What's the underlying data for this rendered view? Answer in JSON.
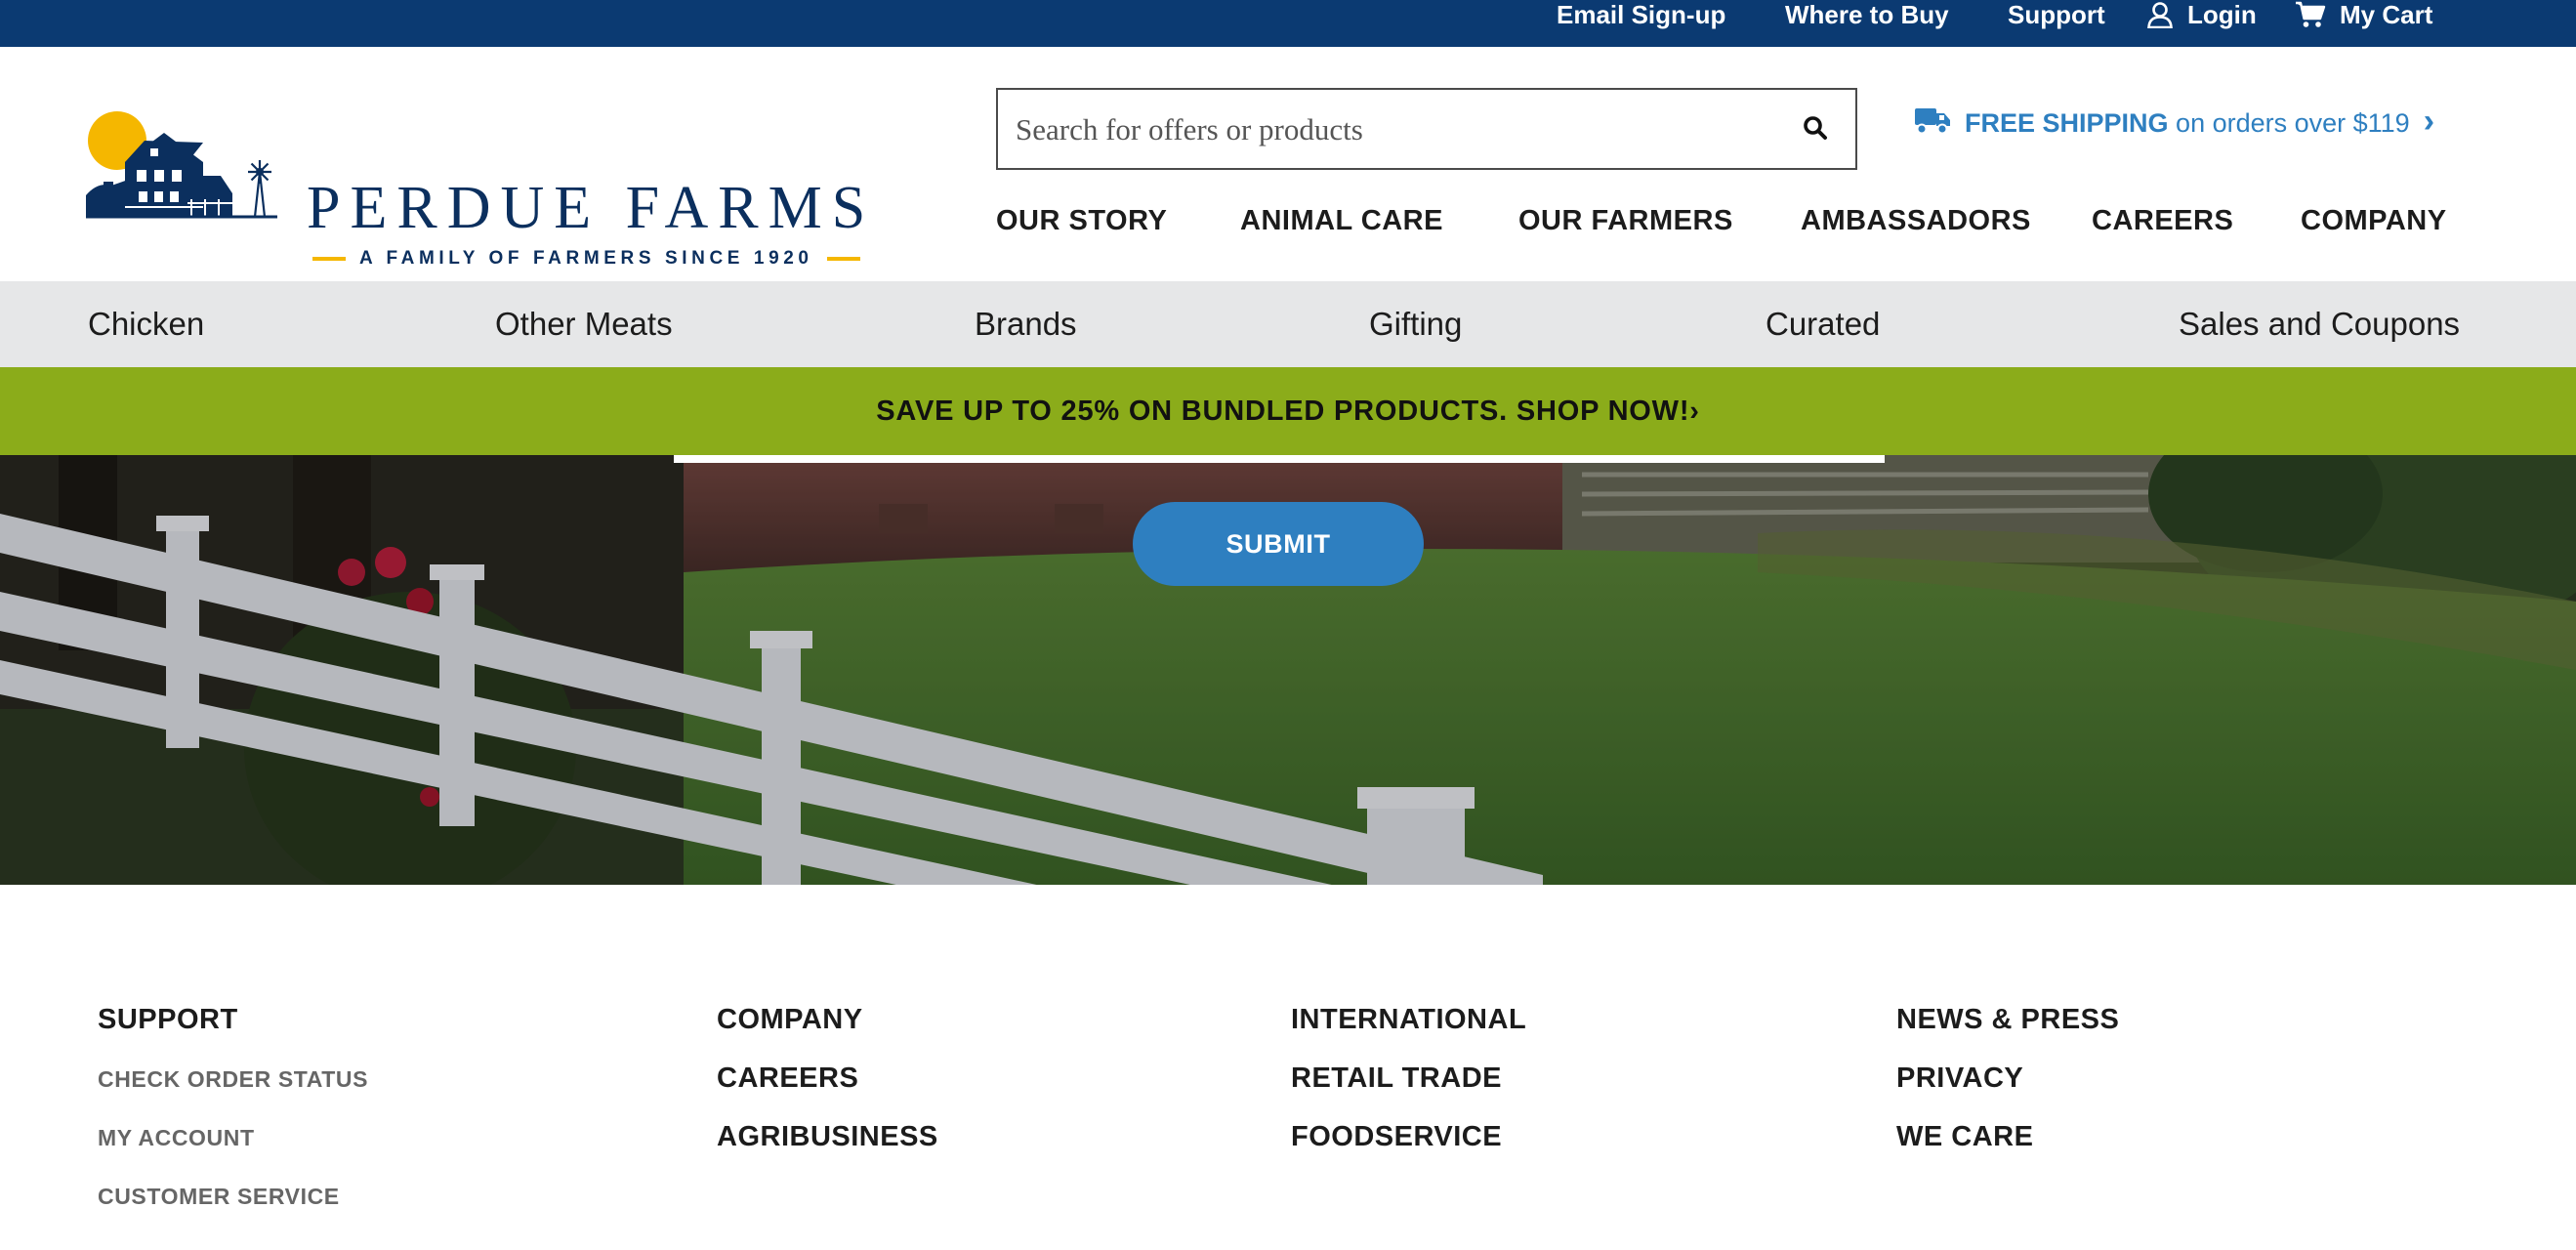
{
  "colors": {
    "utility_bar": "#0b3a72",
    "brand_navy": "#0b2f5e",
    "accent_blue": "#2e7fc0",
    "promo_green": "#8bac1a",
    "category_nav_bg": "#e6e7e8",
    "logo_sun": "#f5b700"
  },
  "utility": {
    "email_signup": "Email Sign-up",
    "where_to_buy": "Where to Buy",
    "support": "Support",
    "login": "Login",
    "login_icon": "user-icon",
    "cart": "My Cart",
    "cart_icon": "cart-icon"
  },
  "brand": {
    "name": "PERDUE FARMS",
    "tagline": "A FAMILY OF FARMERS SINCE 1920"
  },
  "search": {
    "placeholder": "Search for offers or products",
    "value": "",
    "icon": "search-icon"
  },
  "shipping": {
    "icon": "truck-icon",
    "highlight": "FREE SHIPPING",
    "rest": " on orders over $119",
    "chevron": "›"
  },
  "main_nav": [
    {
      "label": "OUR STORY"
    },
    {
      "label": "ANIMAL CARE"
    },
    {
      "label": "OUR FARMERS"
    },
    {
      "label": "AMBASSADORS"
    },
    {
      "label": "CAREERS"
    },
    {
      "label": "COMPANY"
    }
  ],
  "category_nav": [
    {
      "label": "Chicken"
    },
    {
      "label": "Other Meats"
    },
    {
      "label": "Brands"
    },
    {
      "label": "Gifting"
    },
    {
      "label": "Curated"
    },
    {
      "label": "Sales and Coupons"
    }
  ],
  "promo": {
    "text": "SAVE UP TO 25% ON BUNDLED PRODUCTS. SHOP NOW!›"
  },
  "hero": {
    "submit_label": "SUBMIT"
  },
  "footer": {
    "support": {
      "heading": "SUPPORT",
      "links": [
        "CHECK ORDER STATUS",
        "MY ACCOUNT",
        "CUSTOMER SERVICE"
      ]
    },
    "col2": [
      "COMPANY",
      "CAREERS",
      "AGRIBUSINESS"
    ],
    "col3": [
      "INTERNATIONAL",
      "RETAIL TRADE",
      "FOODSERVICE"
    ],
    "col4": [
      "NEWS & PRESS",
      "PRIVACY",
      "WE CARE"
    ]
  }
}
